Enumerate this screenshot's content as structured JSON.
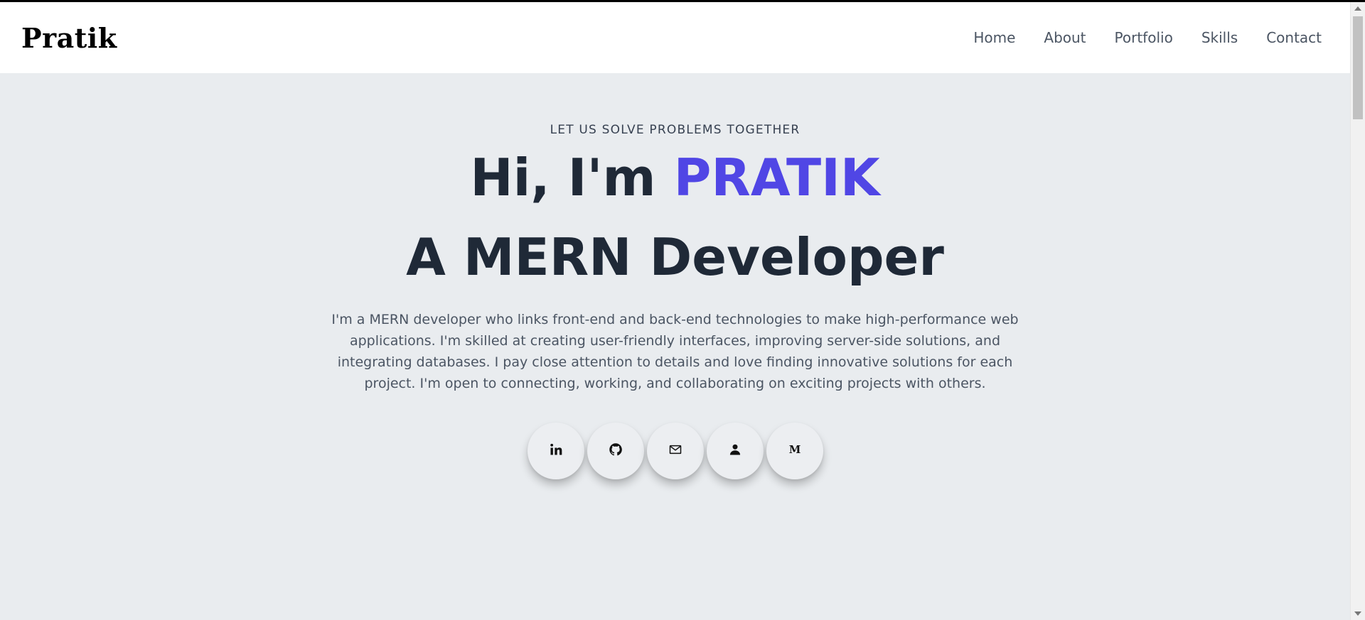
{
  "header": {
    "brand": "Pratik",
    "nav": [
      "Home",
      "About",
      "Portfolio",
      "Skills",
      "Contact"
    ]
  },
  "hero": {
    "tagline": "LET US SOLVE PROBLEMS TOGETHER",
    "greeting": "Hi, I'm ",
    "name": "PRATIK",
    "role": "A MERN Developer",
    "description": "I'm a MERN developer who links front-end and back-end technologies to make high-performance web applications. I'm skilled at creating user-friendly interfaces, improving server-side solutions, and integrating databases. I pay close attention to details and love finding innovative solutions for each project. I'm open to connecting, working, and collaborating on exciting projects with others."
  },
  "socials": [
    {
      "icon": "linkedin-icon"
    },
    {
      "icon": "github-icon"
    },
    {
      "icon": "mail-icon"
    },
    {
      "icon": "person-icon"
    },
    {
      "icon": "medium-icon"
    }
  ],
  "colors": {
    "accent": "#5046e5",
    "heading": "#1f2937",
    "background": "#e9ecef",
    "navbar": "#ffffff"
  }
}
